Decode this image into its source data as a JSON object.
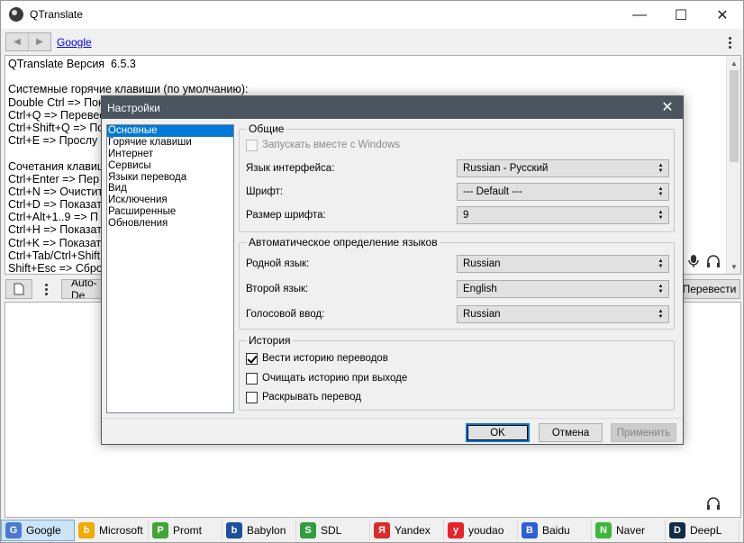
{
  "window": {
    "title": "QTranslate"
  },
  "toolbar": {
    "service_link": "Google"
  },
  "source": {
    "lines": [
      "QTranslate Версия  6.5.3",
      "",
      "Системные горячие клавиши (по умолчанию):",
      "Double Ctrl => Пок",
      "Ctrl+Q => Перевес",
      "Ctrl+Shift+Q => По",
      "Ctrl+E => Прослу",
      "",
      "Сочетания клавиш",
      "Ctrl+Enter => Пер",
      "Ctrl+N => Очистит",
      "Ctrl+D => Показат",
      "Ctrl+Alt+1..9 => П",
      "Ctrl+H => Показат",
      "Ctrl+K => Показат",
      "Ctrl+Tab/Ctrl+Shift",
      "Shift+Esc => Сбро"
    ]
  },
  "toolbar2": {
    "auto_detect": "Auto-De",
    "translate": "Перевести"
  },
  "services": [
    {
      "label": "Google",
      "icon": "google-icon",
      "color": "#4a7bd0",
      "glyph": "G"
    },
    {
      "label": "Microsoft",
      "icon": "bing-icon",
      "color": "#f2a900",
      "glyph": "b"
    },
    {
      "label": "Promt",
      "icon": "promt-icon",
      "color": "#3fa535",
      "glyph": "P"
    },
    {
      "label": "Babylon",
      "icon": "babylon-icon",
      "color": "#1c4f9c",
      "glyph": "b"
    },
    {
      "label": "SDL",
      "icon": "sdl-icon",
      "color": "#2e9e3e",
      "glyph": "S"
    },
    {
      "label": "Yandex",
      "icon": "yandex-icon",
      "color": "#d92c2c",
      "glyph": "Я"
    },
    {
      "label": "youdao",
      "icon": "youdao-icon",
      "color": "#e8242a",
      "glyph": "y"
    },
    {
      "label": "Baidu",
      "icon": "baidu-icon",
      "color": "#2d5fd6",
      "glyph": "B"
    },
    {
      "label": "Naver",
      "icon": "naver-icon",
      "color": "#3cb83c",
      "glyph": "N"
    },
    {
      "label": "DeepL",
      "icon": "deepl-icon",
      "color": "#0f2b46",
      "glyph": "D"
    }
  ],
  "dialog": {
    "title": "Настройки",
    "categories": [
      "Основные",
      "Горячие клавиши",
      "Интернет",
      "Сервисы",
      "Языки перевода",
      "Вид",
      "Исключения",
      "Расширенные",
      "Обновления"
    ],
    "general": {
      "title": "Общие",
      "startup_label": "Запускать вместе с Windows",
      "ui_lang_label": "Язык интерфейса:",
      "ui_lang_value": "Russian - Русский",
      "font_label": "Шрифт:",
      "font_value": "--- Default ---",
      "font_size_label": "Размер шрифта:",
      "font_size_value": "9"
    },
    "autodetect": {
      "title": "Автоматическое определение языков",
      "native_label": "Родной язык:",
      "native_value": "Russian",
      "second_label": "Второй язык:",
      "second_value": "English",
      "voice_label": "Голосовой ввод:",
      "voice_value": "Russian"
    },
    "history": {
      "title": "История",
      "keep_label": "Вести историю переводов",
      "clear_label": "Очищать историю при выходе",
      "expand_label": "Раскрывать перевод"
    },
    "buttons": {
      "ok": "OK",
      "cancel": "Отмена",
      "apply": "Применить"
    }
  },
  "colors": {
    "selection": "#0078d7",
    "dialog_title_bg": "#4a5560",
    "tab_active": "#cce4f7"
  }
}
